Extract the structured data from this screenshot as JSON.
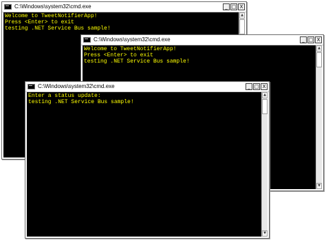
{
  "windows": [
    {
      "title": "C:\\Windows\\system32\\cmd.exe",
      "lines": "Welcome to TweetNotifierApp!\nPress <Enter> to exit\ntesting .NET Service Bus sample!"
    },
    {
      "title": "C:\\Windows\\system32\\cmd.exe",
      "lines": "Welcome to TweetNotifierApp!\nPress <Enter> to exit\ntesting .NET Service Bus sample!"
    },
    {
      "title": "C:\\Windows\\system32\\cmd.exe",
      "lines": "Enter a status update:\ntesting .NET Service Bus sample!"
    }
  ],
  "controls": {
    "minimize": "_",
    "maximize": "□",
    "close": "X"
  },
  "scrollbar": {
    "up_arrow": "▲",
    "down_arrow": "▼"
  },
  "colors": {
    "console_background": "#000000",
    "console_text": "#ffff00"
  }
}
